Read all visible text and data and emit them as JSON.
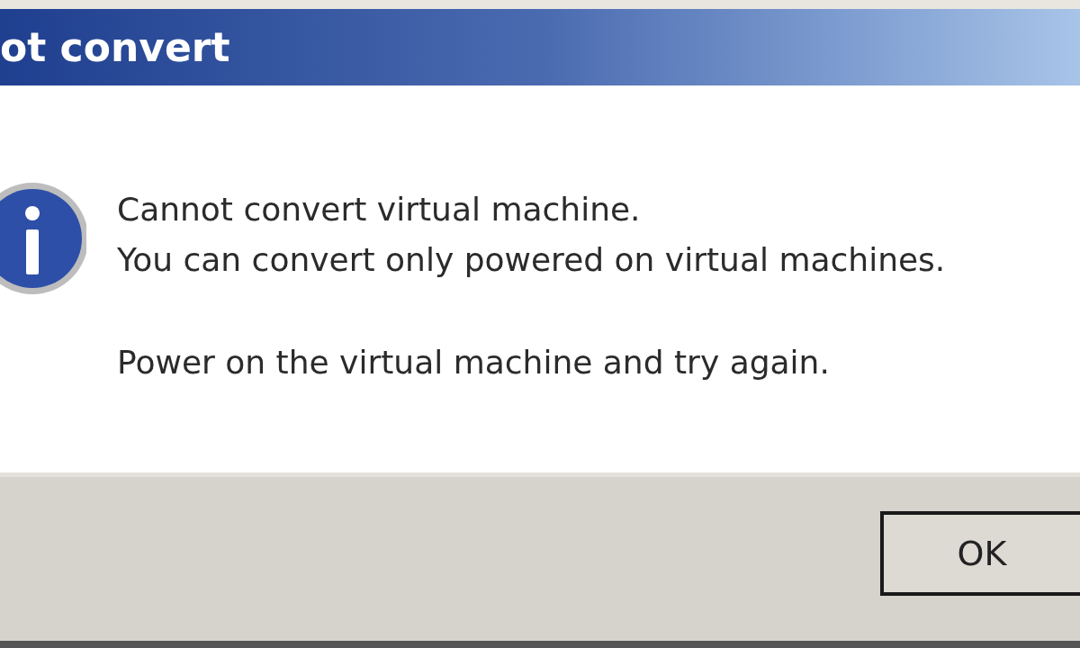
{
  "window": {
    "title": "ot convert"
  },
  "message": {
    "lines": [
      "Cannot convert virtual machine.",
      "You can convert only powered on virtual machines."
    ],
    "hint": "Power on the virtual machine and try again."
  },
  "buttons": [
    {
      "label": "OK"
    }
  ]
}
